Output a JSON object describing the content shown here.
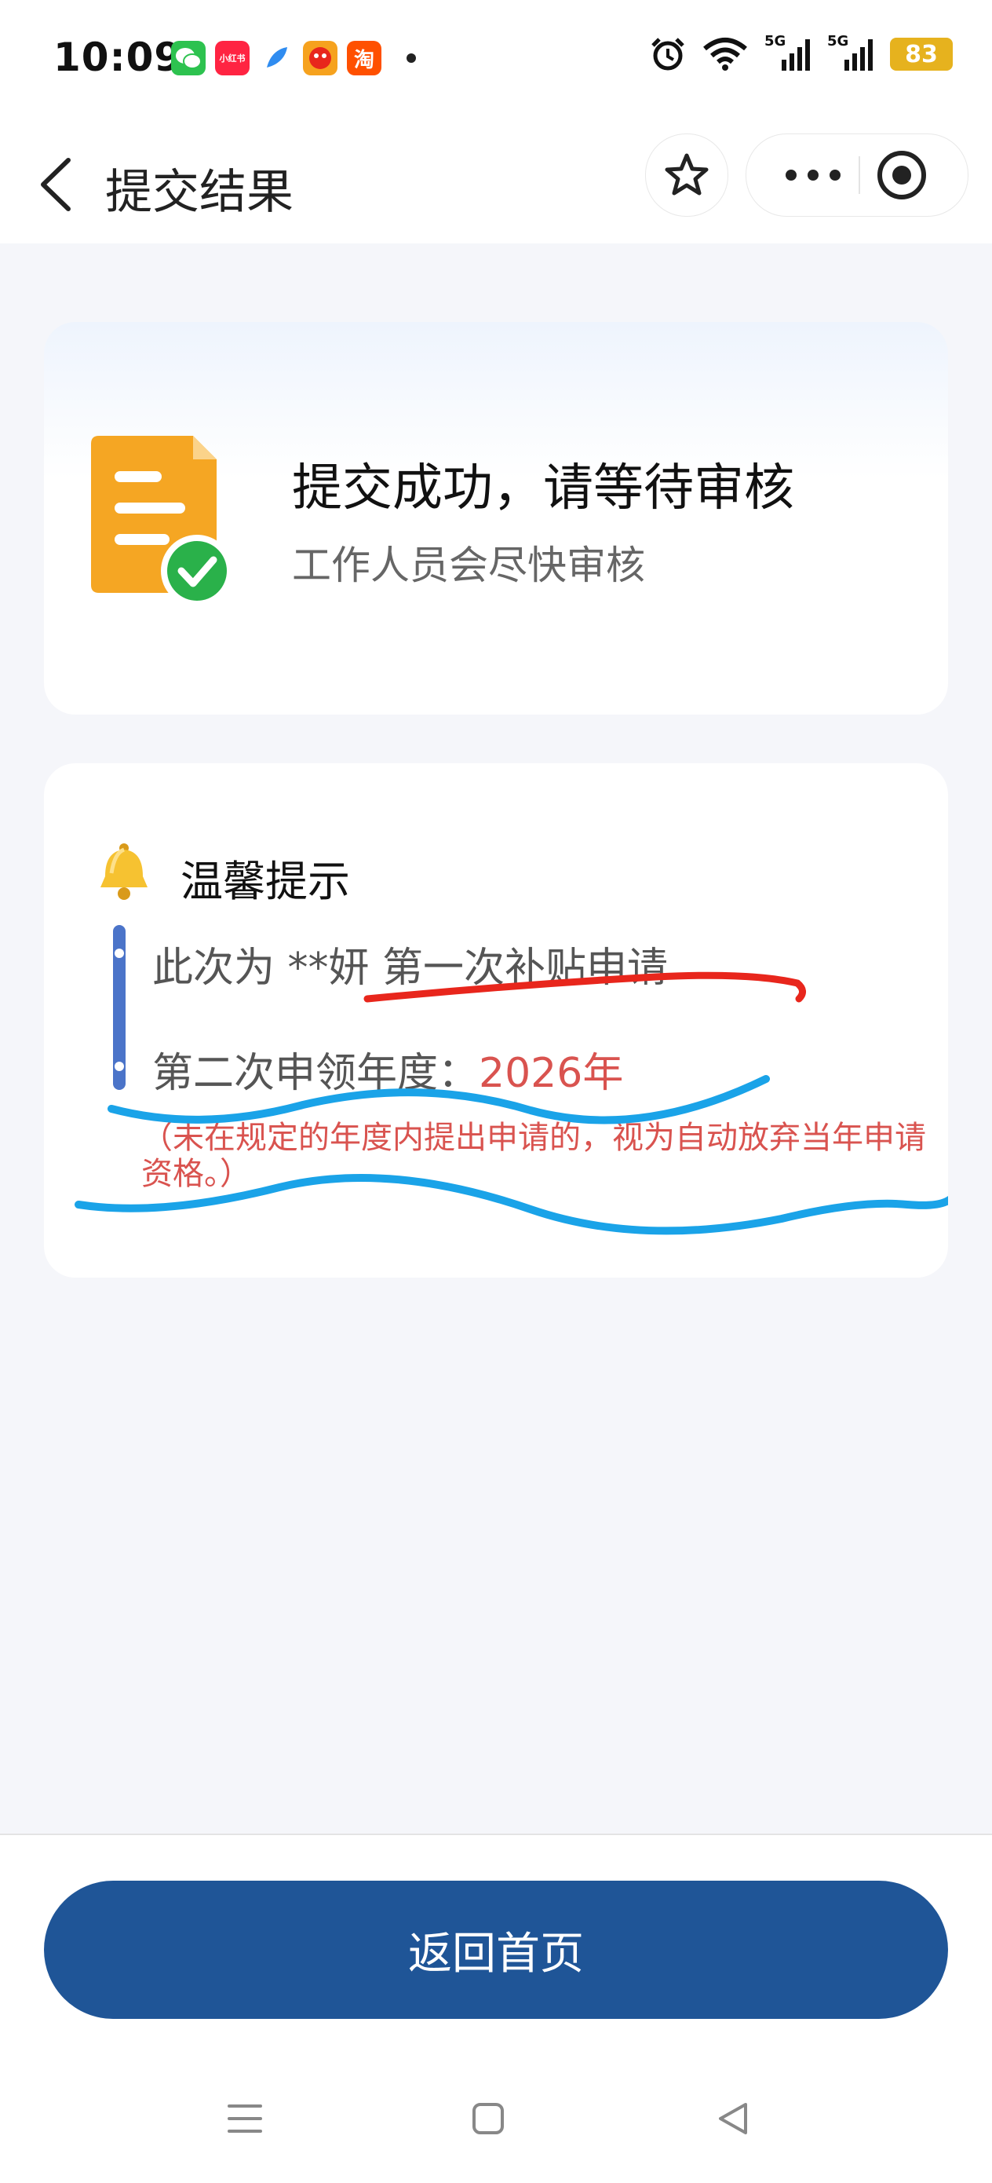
{
  "status_bar": {
    "time": "10:09",
    "notification_icons": [
      "wechat-icon",
      "xiaohongshu-icon",
      "feather-app-icon",
      "game-app-icon",
      "taobao-icon"
    ],
    "app_labels": {
      "xhs": "小红书",
      "taobao": "淘"
    },
    "signal_label_1": "5G",
    "signal_label_2": "5G",
    "battery": "83"
  },
  "nav": {
    "title": "提交结果"
  },
  "success_card": {
    "title": "提交成功，请等待审核",
    "subtitle": "工作人员会尽快审核"
  },
  "tips_card": {
    "title": "温馨提示",
    "line1": "此次为 **妍 第一次补贴申请",
    "line2_label": "第二次申领年度：",
    "line2_year": "2026年",
    "warning": "（未在规定的年度内提出申请的，视为自动放弃当年申请资格。）"
  },
  "footer": {
    "home_button": "返回首页"
  },
  "colors": {
    "primary": "#1f5597",
    "accent_red": "#d9534f",
    "bar_blue": "#4b74c9",
    "check_green": "#2ab14a",
    "doc_orange": "#f5a623",
    "scribble_red": "#e8261c",
    "scribble_blue": "#1aa3e8"
  }
}
